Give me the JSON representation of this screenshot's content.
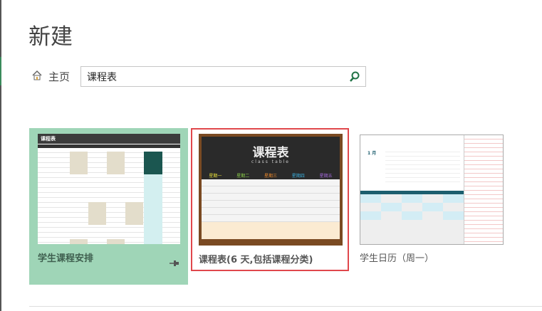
{
  "page_title": "新建",
  "nav": {
    "home_label": "主页"
  },
  "search": {
    "value": "课程表"
  },
  "templates": [
    {
      "label": "学生课程安排",
      "thumb_title": "课程表"
    },
    {
      "label": "课程表(6 天,包括课程分类)",
      "thumb_title": "课程表",
      "thumb_subtitle": "class table",
      "days": [
        "星期一",
        "星期二",
        "星期三",
        "星期四",
        "星期五"
      ]
    },
    {
      "label": "学生日历（周一）",
      "thumb_month": "1 月"
    }
  ],
  "colors": {
    "selected_border": "#e0474c",
    "hover_bg": "#9fd5b7",
    "search_icon": "#217346"
  }
}
